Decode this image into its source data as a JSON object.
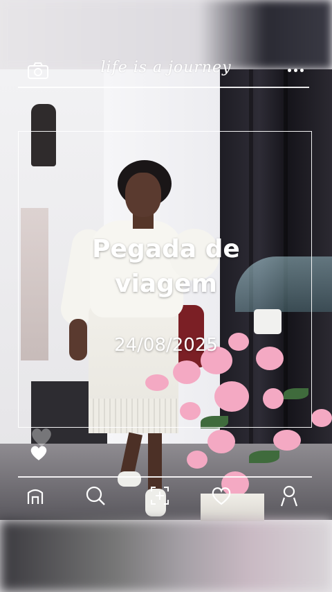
{
  "header": {
    "title": "life is a journey",
    "camera_icon": "camera-icon",
    "more_icon": "more-dots-icon"
  },
  "card": {
    "headline_line1": "Pegada de",
    "headline_line2": "viagem",
    "date": "24/08/2025"
  },
  "reactions": {
    "like_icon": "heart-icon"
  },
  "bottom_nav": {
    "items": [
      {
        "icon": "home-icon"
      },
      {
        "icon": "search-icon"
      },
      {
        "icon": "add-post-icon"
      },
      {
        "icon": "heart-icon"
      },
      {
        "icon": "profile-icon"
      }
    ]
  },
  "colors": {
    "overlay_text": "#ffffff",
    "flower_pink": "#f4a9c3",
    "curtain_dark": "#1e1d24"
  }
}
